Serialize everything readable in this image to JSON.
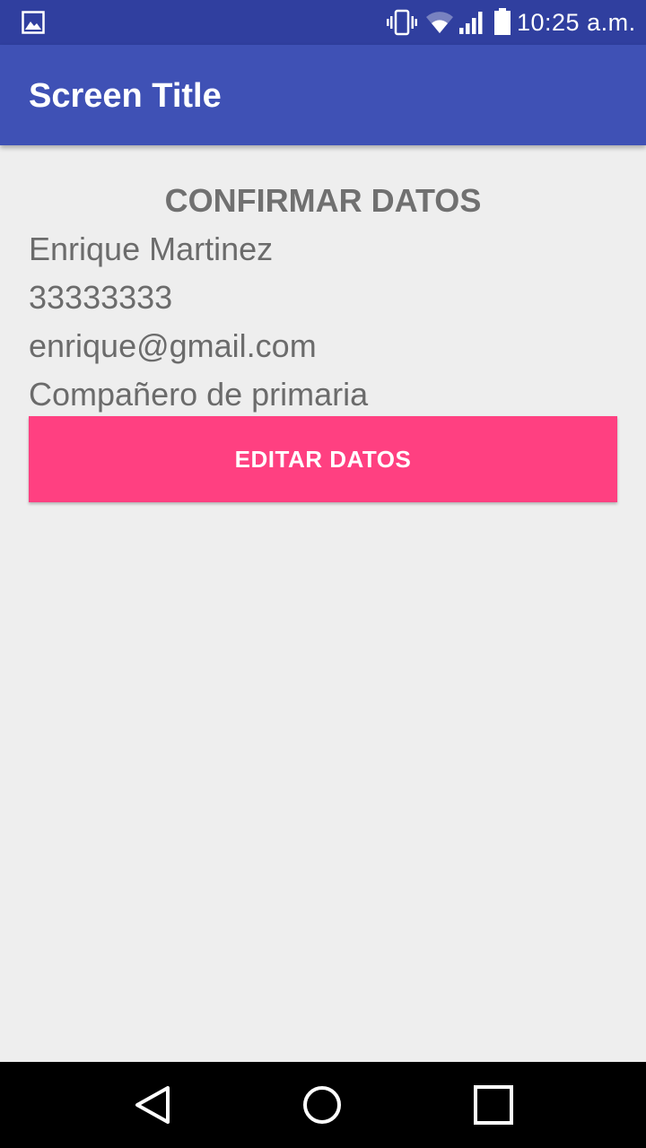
{
  "status_bar": {
    "time": "10:25 a.m.",
    "icons": [
      "gallery-icon",
      "vibrate-icon",
      "wifi-icon",
      "signal-icon",
      "battery-icon"
    ]
  },
  "app_bar": {
    "title": "Screen Title"
  },
  "confirm": {
    "heading": "CONFIRMAR DATOS",
    "name": "Enrique Martinez",
    "phone": "33333333",
    "email": "enrique@gmail.com",
    "relation": "Compañero de primaria",
    "edit_button": "EDITAR DATOS"
  },
  "nav_bar": {
    "icons": [
      "back-icon",
      "home-icon",
      "recents-icon"
    ]
  },
  "colors": {
    "status_bar": "#303f9f",
    "app_bar": "#3f51b5",
    "accent": "#ff4081",
    "background": "#eeeeee",
    "text": "#6b6b6b"
  }
}
